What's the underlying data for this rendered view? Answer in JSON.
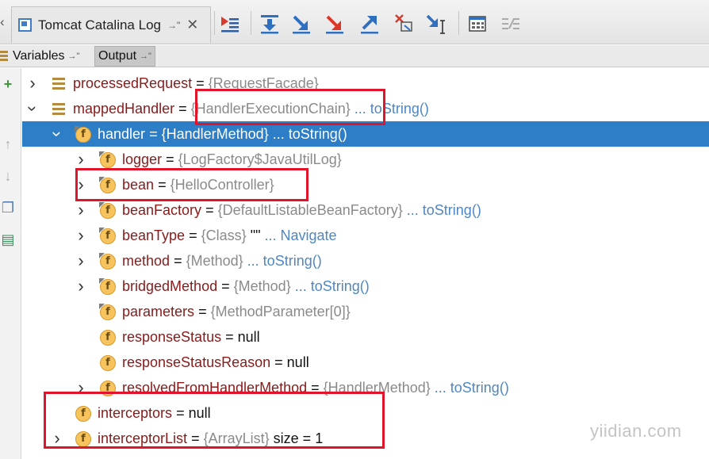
{
  "toolbar": {
    "tab_title": "Tomcat Catalina Log",
    "tab_pin": "→\"",
    "tab_close": "✕"
  },
  "panel_tabs": {
    "variables": "Variables",
    "output": "Output",
    "pin": "→\""
  },
  "tree": {
    "rows": [
      {
        "name": "processedRequest",
        "type": "{RequestFacade}"
      },
      {
        "name": "mappedHandler",
        "type": "{HandlerExecutionChain}",
        "link": "... toString()"
      },
      {
        "name": "handler",
        "type": "{HandlerMethod}",
        "link": "... toString()"
      },
      {
        "name": "logger",
        "type": "{LogFactory$JavaUtilLog}"
      },
      {
        "name": "bean",
        "type": "{HelloController}"
      },
      {
        "name": "beanFactory",
        "type": "{DefaultListableBeanFactory}",
        "link": "... toString()"
      },
      {
        "name": "beanType",
        "type": "{Class}",
        "value": "\"\"",
        "link": "... Navigate"
      },
      {
        "name": "method",
        "type": "{Method}",
        "link": "... toString()"
      },
      {
        "name": "bridgedMethod",
        "type": "{Method}",
        "link": "... toString()"
      },
      {
        "name": "parameters",
        "type": "{MethodParameter[0]}"
      },
      {
        "name": "responseStatus",
        "value": "null"
      },
      {
        "name": "responseStatusReason",
        "value": "null"
      },
      {
        "name": "resolvedFromHandlerMethod",
        "type": "{HandlerMethod}",
        "link": "... toString()"
      },
      {
        "name": "interceptors",
        "value": "null"
      },
      {
        "name": "interceptorList",
        "type": "{ArrayList}",
        "value": "size = 1"
      }
    ],
    "equals": "="
  },
  "watermark": "yiidian.com",
  "colors": {
    "selection": "#2e7ec7",
    "highlight_box": "#e0142b",
    "field_name": "#8a1a1a",
    "type_text": "#8a8a8a",
    "link": "#4f86c4",
    "field_icon": "#f7c35c"
  }
}
